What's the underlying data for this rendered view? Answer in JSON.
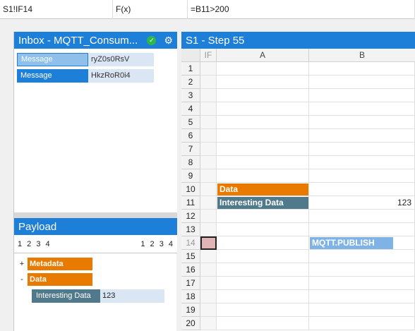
{
  "formula_bar": {
    "cell_ref": "S1!IF14",
    "fx": "F(x)",
    "formula": "=B11>200"
  },
  "inbox": {
    "title": "Inbox - MQTT_Consum...",
    "messages": [
      {
        "label": "Message",
        "value": "ryZ0s0RsV"
      },
      {
        "label": "Message",
        "value": "HkzRoR0i4"
      }
    ]
  },
  "payload": {
    "title": "Payload",
    "levels_left": "1 2 3 4",
    "levels_right": "1 2 3 4",
    "tree": [
      {
        "toggle": "+",
        "label": "Metadata"
      },
      {
        "toggle": "-",
        "label": "Data"
      }
    ],
    "leaf": {
      "label": "Interesting Data",
      "value": "123"
    }
  },
  "sheet": {
    "title": "S1 - Step 55",
    "columns": [
      "IF",
      "A",
      "B"
    ],
    "rows": [
      "1",
      "2",
      "3",
      "4",
      "5",
      "6",
      "7",
      "8",
      "9",
      "10",
      "11",
      "12",
      "13",
      "14",
      "15",
      "16",
      "17",
      "18",
      "19",
      "20"
    ],
    "cells": {
      "a10": "Data",
      "a11": "Interesting Data",
      "b11": "123",
      "b14": "MQTT.PUBLISH"
    },
    "selected_row": "14"
  },
  "colors": {
    "accent": "#1e7fd8",
    "orange": "#e87a00",
    "slate": "#507a8c",
    "publish": "#7fb2e5",
    "selected_cell": "#e0b4b4"
  }
}
